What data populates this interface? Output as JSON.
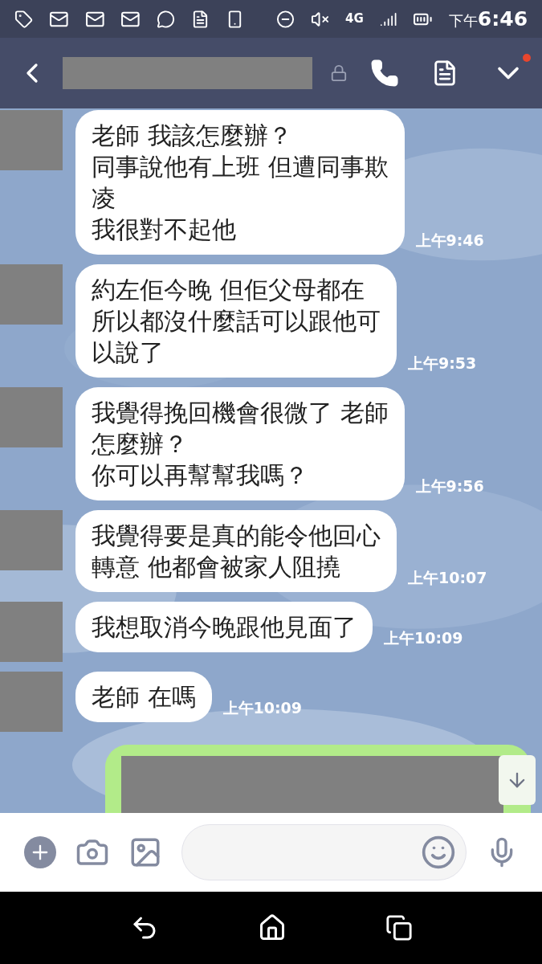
{
  "status_bar": {
    "network": "4G",
    "time_prefix": "下午",
    "time": "6:46"
  },
  "header": {
    "notification": true
  },
  "messages": [
    {
      "kind": "received",
      "lines": [
        "老師 我該怎麼辦？",
        "同事說他有上班 但遭同事欺",
        "凌",
        "我很對不起他"
      ],
      "time": "上午9:46"
    },
    {
      "kind": "received",
      "lines": [
        "約左佢今晚 但佢父母都在",
        "所以都沒什麼話可以跟他可",
        "以說了"
      ],
      "time": "上午9:53"
    },
    {
      "kind": "received",
      "lines": [
        "我覺得挽回機會很微了 老師",
        "怎麼辦？",
        "你可以再幫幫我嗎？"
      ],
      "time": "上午9:56"
    },
    {
      "kind": "received",
      "lines": [
        "我覺得要是真的能令他回心",
        "轉意 他都會被家人阻撓"
      ],
      "time": "上午10:07"
    },
    {
      "kind": "received",
      "lines": [
        "我想取消今晚跟他見面了"
      ],
      "time": "上午10:09"
    },
    {
      "kind": "received",
      "lines": [
        "老師 在嗎"
      ],
      "time": "上午10:09"
    },
    {
      "kind": "sent_redacted"
    }
  ]
}
